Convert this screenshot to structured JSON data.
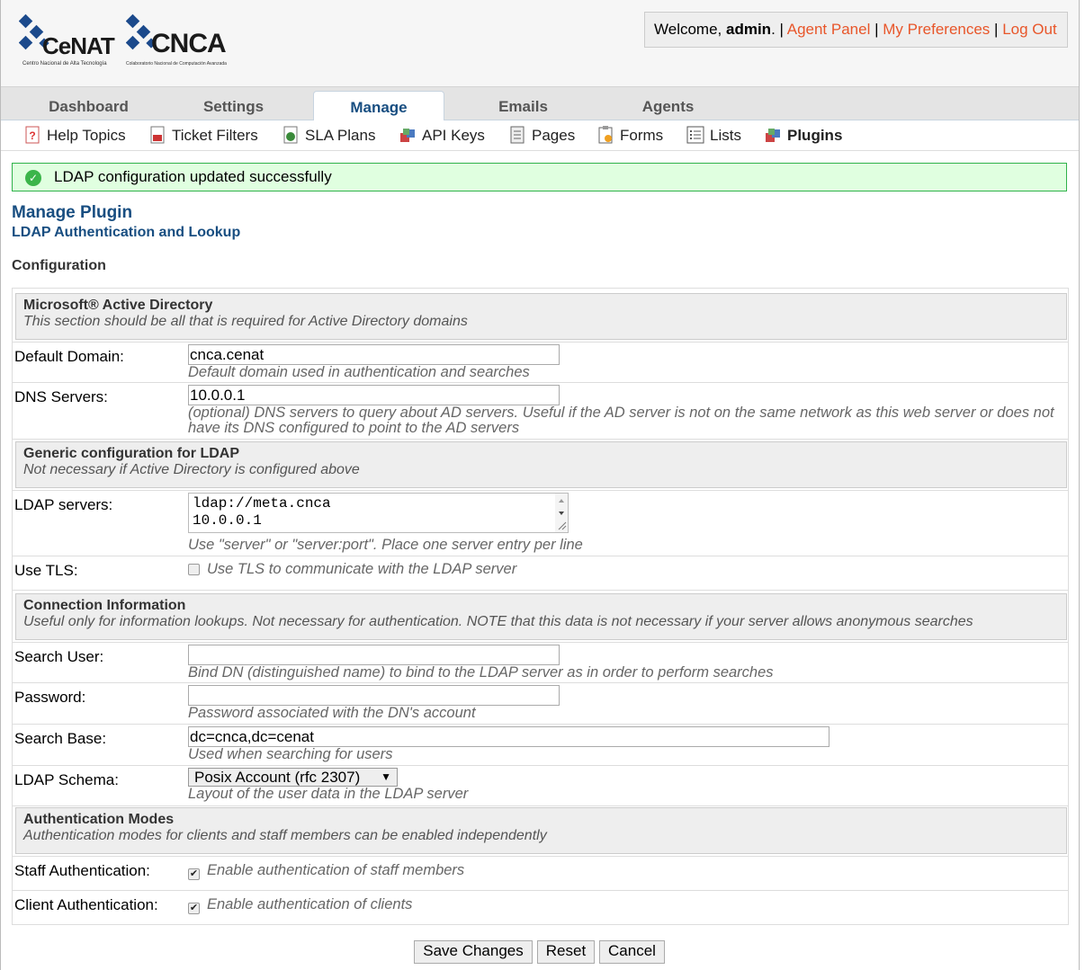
{
  "header": {
    "logo_cenat": {
      "name": "CeNAT",
      "tagline": "Centro Nacional de Alta Tecnología"
    },
    "logo_cnca": {
      "name": "CNCA",
      "tagline": "Colaboratorio Nacional de Computación Avanzada"
    },
    "welcome_prefix": "Welcome,",
    "user": "admin",
    "welcome_suffix": ". |",
    "agent_panel": "Agent Panel",
    "my_preferences": "My Preferences",
    "log_out": "Log Out",
    "sep": "|"
  },
  "nav": {
    "tabs": [
      {
        "label": "Dashboard"
      },
      {
        "label": "Settings"
      },
      {
        "label": "Manage"
      },
      {
        "label": "Emails"
      },
      {
        "label": "Agents"
      }
    ],
    "active_tab": "Manage"
  },
  "subnav": {
    "items": [
      {
        "label": "Help Topics",
        "icon": "help-topics-icon"
      },
      {
        "label": "Ticket Filters",
        "icon": "ticket-filters-icon"
      },
      {
        "label": "SLA Plans",
        "icon": "sla-plans-icon"
      },
      {
        "label": "API Keys",
        "icon": "api-keys-icon"
      },
      {
        "label": "Pages",
        "icon": "pages-icon"
      },
      {
        "label": "Forms",
        "icon": "forms-icon"
      },
      {
        "label": "Lists",
        "icon": "lists-icon"
      },
      {
        "label": "Plugins",
        "icon": "plugins-icon"
      }
    ],
    "active_item": "Plugins"
  },
  "message": {
    "text": "LDAP configuration updated successfully",
    "icon": "check-circle-icon"
  },
  "page": {
    "title": "Manage Plugin",
    "subtitle": "LDAP Authentication and Lookup",
    "section": "Configuration"
  },
  "sections": {
    "ad": {
      "title": "Microsoft® Active Directory",
      "desc": "This section should be all that is required for Active Directory domains"
    },
    "generic": {
      "title": "Generic configuration for LDAP",
      "desc": "Not necessary if Active Directory is configured above"
    },
    "connection": {
      "title": "Connection Information",
      "desc": "Useful only for information lookups. Not necessary for authentication. NOTE that this data is not necessary if your server allows anonymous searches"
    },
    "auth": {
      "title": "Authentication Modes",
      "desc": "Authentication modes for clients and staff members can be enabled independently"
    }
  },
  "fields": {
    "default_domain": {
      "label": "Default Domain:",
      "value": "cnca.cenat",
      "hint": "Default domain used in authentication and searches"
    },
    "dns_servers": {
      "label": "DNS Servers:",
      "value": "10.0.0.1",
      "hint": "(optional) DNS servers to query about AD servers. Useful if the AD server is not on the same network as this web server or does not have its DNS configured to point to the AD servers"
    },
    "ldap_servers": {
      "label": "LDAP servers:",
      "lines": [
        "ldap://meta.cnca",
        "10.0.0.1"
      ],
      "hint": "Use \"server\" or \"server:port\". Place one server entry per line"
    },
    "use_tls": {
      "label": "Use TLS:",
      "checked": false,
      "text": "Use TLS to communicate with the LDAP server"
    },
    "search_user": {
      "label": "Search User:",
      "value": "",
      "hint": "Bind DN (distinguished name) to bind to the LDAP server as in order to perform searches"
    },
    "password": {
      "label": "Password:",
      "value": "",
      "hint": "Password associated with the DN's account"
    },
    "search_base": {
      "label": "Search Base:",
      "value": "dc=cnca,dc=cenat",
      "hint": "Used when searching for users"
    },
    "ldap_schema": {
      "label": "LDAP Schema:",
      "value": "Posix Account (rfc 2307)",
      "hint": "Layout of the user data in the LDAP server"
    },
    "staff_auth": {
      "label": "Staff Authentication:",
      "checked": true,
      "text": "Enable authentication of staff members"
    },
    "client_auth": {
      "label": "Client Authentication:",
      "checked": true,
      "text": "Enable authentication of clients"
    }
  },
  "buttons": {
    "save": "Save Changes",
    "reset": "Reset",
    "cancel": "Cancel"
  },
  "colors": {
    "link": "#e8562a",
    "heading": "#184e81",
    "success_bg": "#e0ffe0",
    "success_border": "#2fb24a"
  }
}
